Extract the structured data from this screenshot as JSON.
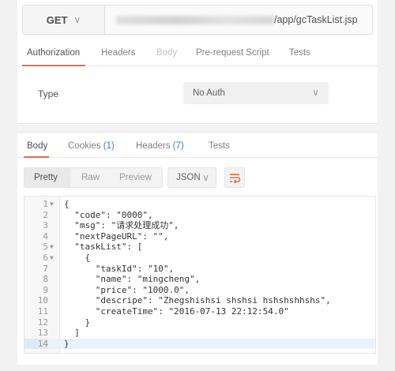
{
  "request": {
    "method": "GET",
    "url_suffix": "/app/gcTaskList.jsp",
    "tabs": [
      "Authorization",
      "Headers",
      "Body",
      "Pre-request Script",
      "Tests"
    ],
    "auth_type_label": "Type",
    "auth_type_value": "No Auth"
  },
  "response": {
    "tabs": {
      "body": "Body",
      "cookies": "Cookies",
      "cookies_count": "(1)",
      "headers": "Headers",
      "headers_count": "(7)",
      "tests": "Tests"
    },
    "formats": [
      "Pretty",
      "Raw",
      "Preview"
    ],
    "language": "JSON"
  },
  "editor": {
    "lines": [
      "{",
      "  \"code\": \"0000\",",
      "  \"msg\": \"请求处理成功\",",
      "  \"nextPageURL\": \"\",",
      "  \"taskList\": [",
      "    {",
      "      \"taskId\": \"10\",",
      "      \"name\": \"mingcheng\",",
      "      \"price\": \"1000.0\",",
      "      \"descripe\": \"Zhegshishsi shshsi hshshshhshs\",",
      "      \"createTime\": \"2016-07-13 22:12:54.0\"",
      "    }",
      "  ]",
      "}"
    ],
    "line_numbers": [
      "1",
      "2",
      "3",
      "4",
      "5",
      "6",
      "7",
      "8",
      "9",
      "10",
      "11",
      "12",
      "13",
      "14"
    ],
    "foldable_lines": [
      "1",
      "5",
      "6"
    ],
    "current_line": "14"
  },
  "colors": {
    "accent": "#f26b3a",
    "count": "#3a7bd5"
  },
  "icons": {
    "method_dropdown": "chevron-down-icon",
    "wrap": "wrap-lines-icon"
  }
}
